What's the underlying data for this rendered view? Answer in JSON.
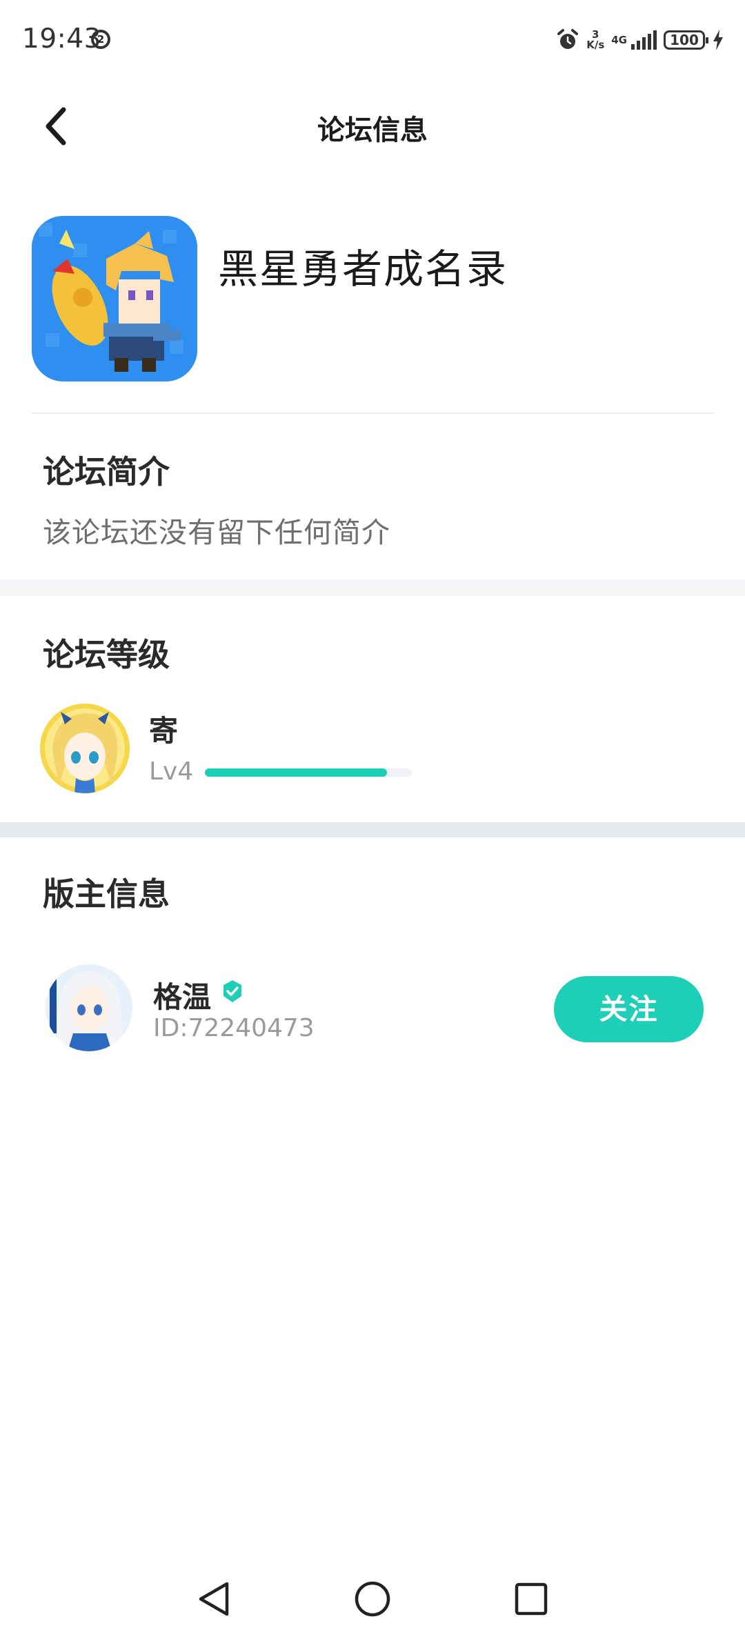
{
  "status_bar": {
    "time": "19:43",
    "time_badge": "2",
    "net_speed_value": "3",
    "net_speed_unit": "K/s",
    "network": "4G",
    "battery": "100"
  },
  "nav": {
    "title": "论坛信息"
  },
  "forum": {
    "name": "黑星勇者成名录"
  },
  "intro": {
    "title": "论坛简介",
    "text": "该论坛还没有留下任何简介"
  },
  "level": {
    "title": "论坛等级",
    "user_name": "寄",
    "level_label": "Lv4",
    "progress_fraction": 0.88
  },
  "moderator": {
    "title": "版主信息",
    "name": "格温",
    "id_text": "ID:72240473",
    "follow_label": "关注"
  },
  "colors": {
    "accent": "#1ecfb8",
    "text_primary": "#2a2a2a",
    "text_secondary": "#9a9a9a",
    "band": "#f4f6f8"
  },
  "icons": [
    "back-arrow-icon",
    "alarm-icon",
    "signal-icon",
    "battery-icon",
    "charging-bolt-icon",
    "verified-icon",
    "nav-back-icon",
    "nav-home-icon",
    "nav-recent-icon"
  ]
}
